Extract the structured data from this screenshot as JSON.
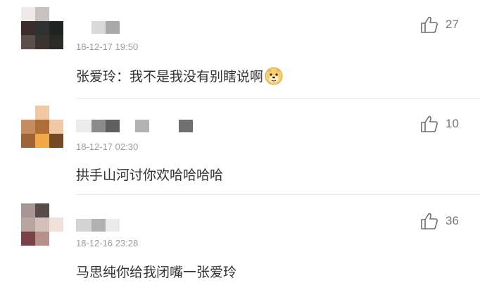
{
  "comments": [
    {
      "timestamp": "18-12-17 19:50",
      "text": "张爱玲：我不是我没有别瞎说啊",
      "likes": "27",
      "has_emoji": true,
      "avatar_colors": [
        "#efe9e7",
        "#c7c1c0",
        "#ffffff",
        "#3b2b29",
        "#2e3331",
        "#1f2323",
        "#5c4e48",
        "#3a332f",
        "#2b2a27"
      ],
      "name_blocks": [
        "#ffffff",
        "#d9d9d9",
        "#a8a8a8",
        "#ffffff"
      ]
    },
    {
      "timestamp": "18-12-17 02:30",
      "text": "拱手山河讨你欢哈哈哈哈",
      "likes": "10",
      "has_emoji": false,
      "avatar_colors": [
        "#ffffff",
        "#f0c9a4",
        "#ffffff",
        "#c68b5e",
        "#b06d3a",
        "#f2c7a5",
        "#9d6338",
        "#f2a849",
        "#754823"
      ],
      "name_blocks": [
        "#ececec",
        "#8b8b8b",
        "#5f5f5f",
        "#ffffff",
        "#b3b3b3",
        "#ffffff",
        "#ffffff",
        "#6f6f6f"
      ]
    },
    {
      "timestamp": "18-12-16 23:28",
      "text": "马思纯你给我闭嘴一张爱玲",
      "likes": "36",
      "has_emoji": false,
      "avatar_colors": [
        "#a89694",
        "#5a4b4b",
        "#ffffff",
        "#b9a4a0",
        "#d2c0b9",
        "#efe1d9",
        "#7a4149",
        "#b7908a",
        "#ffffff"
      ],
      "name_blocks": [
        "#d4d4d4",
        "#b1b1b1",
        "#ebebeb"
      ]
    }
  ]
}
